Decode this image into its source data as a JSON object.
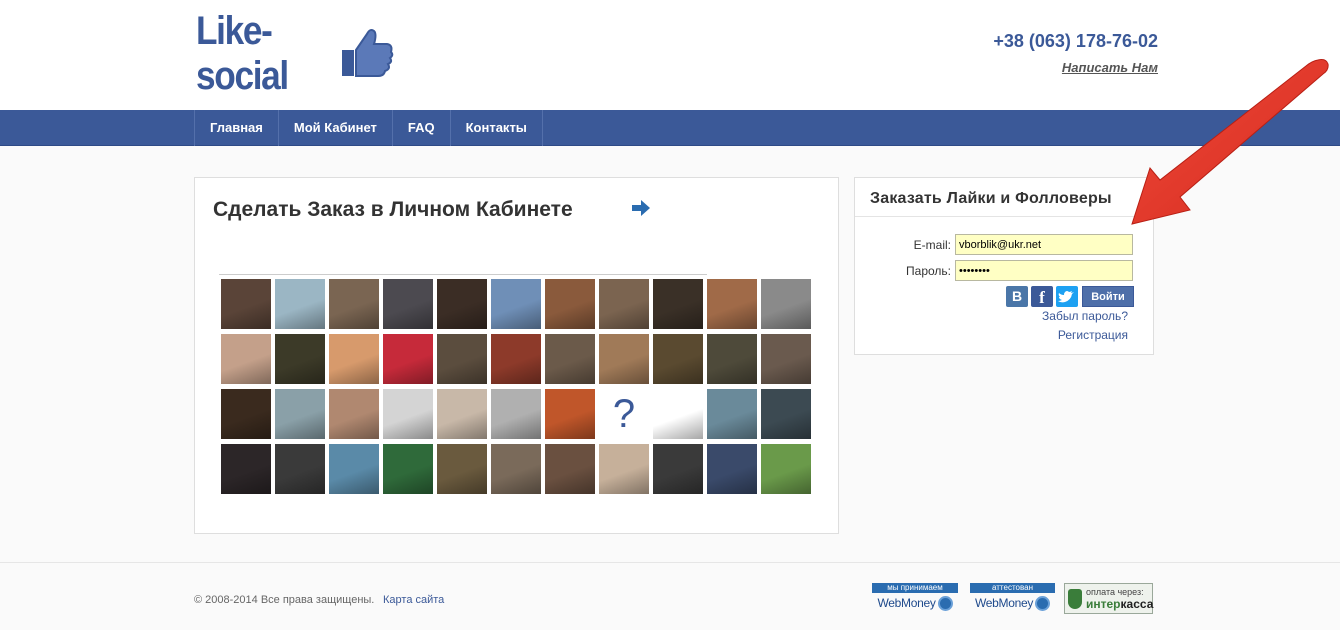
{
  "header": {
    "logo_text": "Like-social",
    "phone": "+38 (063) 178-76-02",
    "write_link": "Написать Нам"
  },
  "nav": {
    "items": [
      {
        "label": "Главная"
      },
      {
        "label": "Мой Кабинет"
      },
      {
        "label": "FAQ"
      },
      {
        "label": "Контакты"
      }
    ]
  },
  "main": {
    "title": "Сделать Заказ в Личном Кабинете",
    "photos": [
      "#5a4438",
      "#9bb6c4",
      "#7a6552",
      "#4c4a50",
      "#3b2d25",
      "#6f8fb7",
      "#8a5a3c",
      "#7b6450",
      "#3a3027",
      "#a06a48",
      "#8a8a8a",
      "#c4a08a",
      "#3c3a28",
      "#d79a6c",
      "#c62a3a",
      "#5b4d3e",
      "#8d3a2a",
      "#6b5a4a",
      "#a07a58",
      "#5a4a30",
      "#4e4a3a",
      "#6a5a4e",
      "#3a2a1e",
      "#8aa0a8",
      "#b08870",
      "#d4d4d4",
      "#c8b8a8",
      "#b0b0b0",
      "#c0562a",
      "#b83a2a",
      "#ffffff",
      "#6a8a9a",
      "#3c4a52",
      "#2c2628",
      "#3a3a3a",
      "#5a8aa8",
      "#2f6a3a",
      "#6a5a3e",
      "#7a6a5a",
      "#6a5040",
      "#c6b09a",
      "#3a3a3a",
      "#3a4a6a",
      "#6a9a4a"
    ]
  },
  "login": {
    "title": "Заказать Лайки и Фолловеры",
    "email_label": "E-mail:",
    "email_value": "vborblik@ukr.net",
    "password_label": "Пароль:",
    "password_value": "••••••••",
    "vk_label": "В",
    "fb_label": "f",
    "login_button": "Войти",
    "forgot_link": "Забыл пароль?",
    "register_link": "Регистрация"
  },
  "footer": {
    "copyright": "© 2008-2014 Все права защищены.",
    "sitemap": "Карта сайта",
    "wm_accept_head": "мы принимаем",
    "wm_accept_text": "WebMoney",
    "wm_attest_head": "аттестован",
    "wm_attest_text": "WebMoney",
    "interkassa_top": "оплата через:",
    "interkassa_bottom_a": "интер",
    "interkassa_bottom_b": "касса"
  },
  "colors": {
    "brand": "#3b5998",
    "annotation_arrow": "#e53226",
    "input_bg": "#ffffc4"
  }
}
